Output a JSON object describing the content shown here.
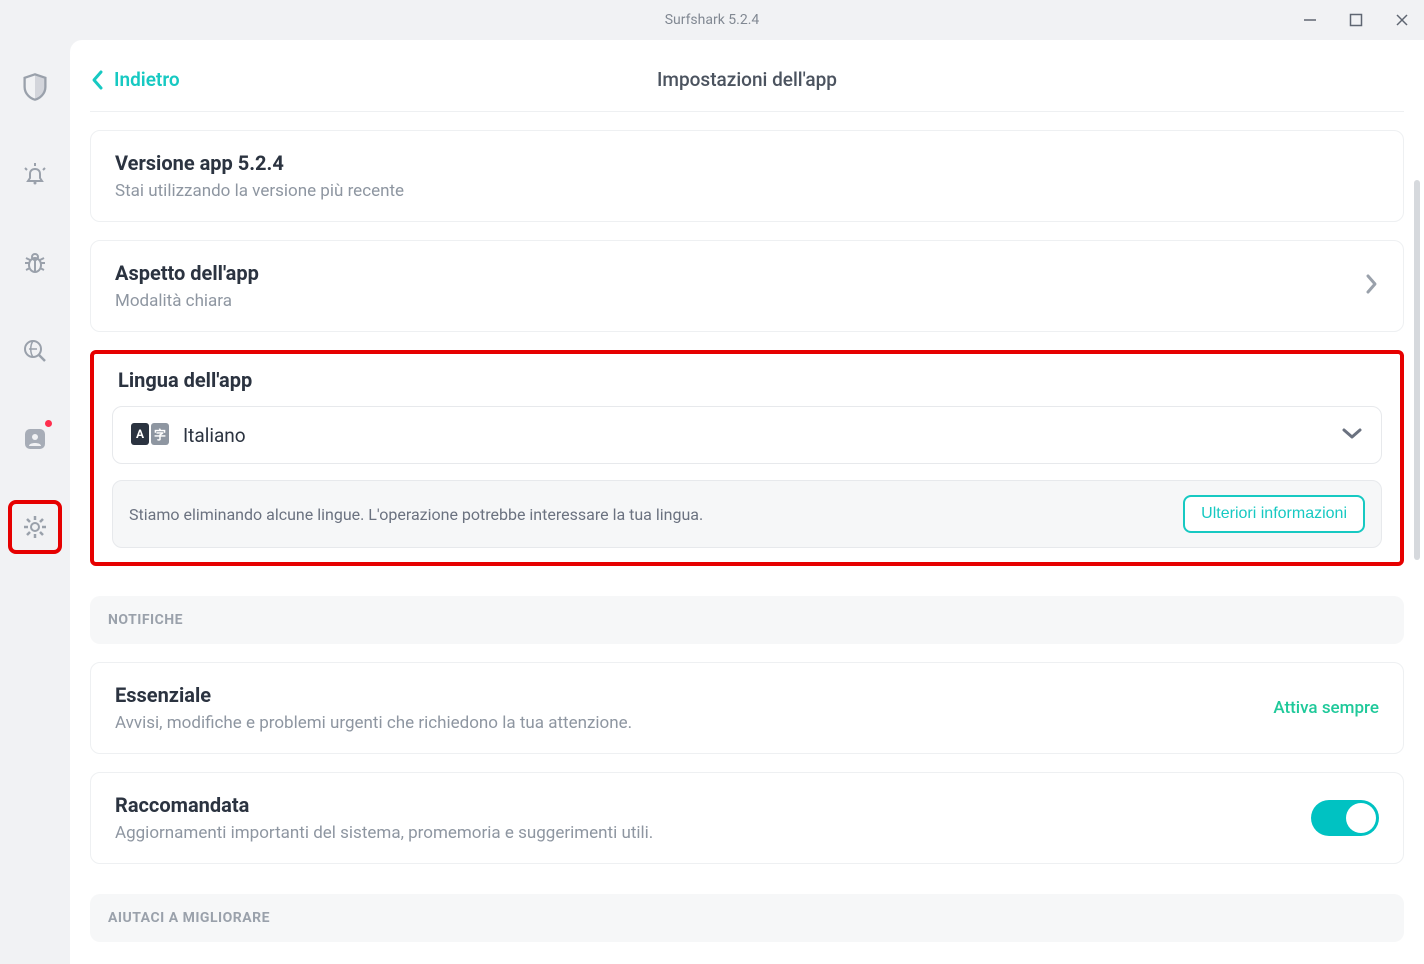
{
  "window": {
    "title": "Surfshark 5.2.4"
  },
  "header": {
    "back_label": "Indietro",
    "page_title": "Impostazioni dell'app"
  },
  "version_card": {
    "title": "Versione app 5.2.4",
    "subtitle": "Stai utilizzando la versione più recente"
  },
  "appearance_card": {
    "title": "Aspetto dell'app",
    "subtitle": "Modalità chiara"
  },
  "language": {
    "title": "Lingua dell'app",
    "selected": "Italiano",
    "notice": "Stiamo eliminando alcune lingue. L'operazione potrebbe interessare la tua lingua.",
    "more_info": "Ulteriori informazioni"
  },
  "sections": {
    "notifications": "NOTIFICHE",
    "help_improve": "AIUTACI A MIGLIORARE"
  },
  "notif_essential": {
    "title": "Essenziale",
    "subtitle": "Avvisi, modifiche e problemi urgenti che richiedono la tua attenzione.",
    "status": "Attiva sempre"
  },
  "notif_recommended": {
    "title": "Raccomandata",
    "subtitle": "Aggiornamenti importanti del sistema, promemoria e suggerimenti utili.",
    "toggle_on": true
  }
}
